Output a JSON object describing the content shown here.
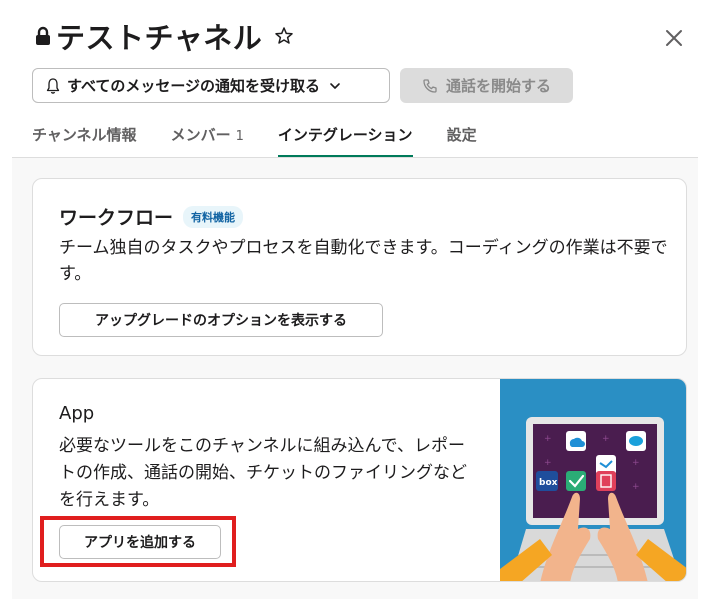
{
  "header": {
    "channel_name": "テストチャネル",
    "notify_label": "すべてのメッセージの通知を受け取る",
    "call_label": "通話を開始する"
  },
  "tabs": [
    {
      "label": "チャンネル情報",
      "active": false
    },
    {
      "label": "メンバー",
      "count": "1",
      "active": false
    },
    {
      "label": "インテグレーション",
      "active": true
    },
    {
      "label": "設定",
      "active": false
    }
  ],
  "workflow": {
    "title": "ワークフロー",
    "badge": "有料機能",
    "description": "チーム独自のタスクやプロセスを自動化できます。コーディングの作業は不要です。",
    "button_label": "アップグレードのオプションを表示する"
  },
  "apps": {
    "title": "App",
    "description": "必要なツールをこのチャンネルに組み込んで、レポートの作成、通話の開始、チケットのファイリングなどを行えます。",
    "button_label": "アプリを追加する",
    "illustration_label": "box"
  },
  "colors": {
    "accent": "#007a5a",
    "highlight": "#e01e1e",
    "illustration_bg": "#2a8fc4",
    "laptop_screen": "#4a1d4f"
  }
}
